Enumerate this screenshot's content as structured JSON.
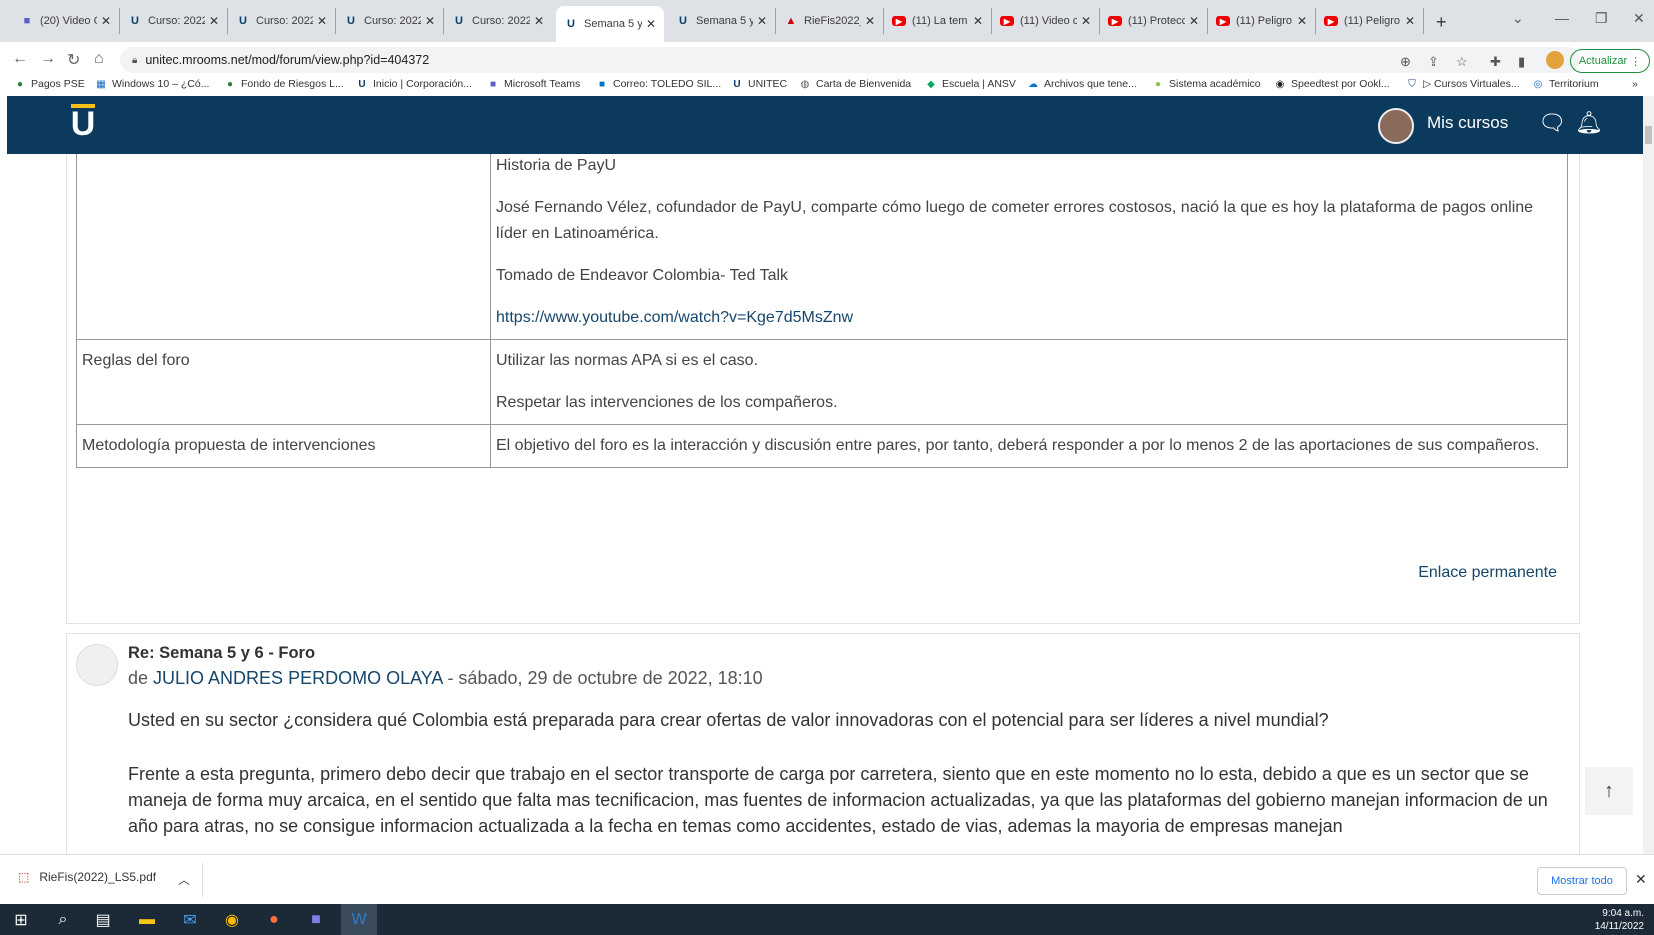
{
  "browser": {
    "tabs": [
      {
        "title": "(20) Video C",
        "icon": "teams-icon"
      },
      {
        "title": "Curso: 2022",
        "icon": "unitec-icon"
      },
      {
        "title": "Curso: 2022",
        "icon": "unitec-icon"
      },
      {
        "title": "Curso: 2022",
        "icon": "unitec-icon"
      },
      {
        "title": "Curso: 2022",
        "icon": "unitec-icon"
      },
      {
        "title": "Semana 5 y",
        "icon": "unitec-icon",
        "active": true
      },
      {
        "title": "Semana 5 y",
        "icon": "unitec-icon"
      },
      {
        "title": "RieFis2022_",
        "icon": "pdf-icon"
      },
      {
        "title": "(11) La tem",
        "icon": "youtube-icon"
      },
      {
        "title": "(11) Video c",
        "icon": "youtube-icon"
      },
      {
        "title": "(11) Protecc",
        "icon": "youtube-icon"
      },
      {
        "title": "(11) Peligro",
        "icon": "youtube-icon"
      },
      {
        "title": "(11) Peligro",
        "icon": "youtube-icon"
      }
    ],
    "url": "unitec.mrooms.net/mod/forum/view.php?id=404372",
    "update_label": "Actualizar",
    "bookmarks": [
      "Pagos PSE",
      "Windows 10 – ¿Có...",
      "Fondo de Riesgos L...",
      "Inicio | Corporación...",
      "Microsoft Teams",
      "Correo: TOLEDO SIL...",
      "UNITEC",
      "Carta de Bienvenida",
      "Escuela | ANSV",
      "Archivos que tene...",
      "Sistema académico",
      "Speedtest por Ookl...",
      "▷ Cursos Virtuales...",
      "Territorium"
    ]
  },
  "navbar": {
    "logo": "U",
    "mis_cursos": "Mis cursos"
  },
  "forum_table": {
    "rows": [
      {
        "key": "",
        "paragraphs": [
          "Historia de PayU",
          "José Fernando Vélez, cofundador de PayU, comparte cómo luego de cometer errores costosos, nació la que es hoy la plataforma de pagos online líder en Latinoamérica.",
          "Tomado de Endeavor Colombia- Ted Talk"
        ],
        "link": "https://www.youtube.com/watch?v=Kge7d5MsZnw"
      },
      {
        "key": "Reglas del foro",
        "paragraphs": [
          "Utilizar las normas APA si es el caso.",
          "Respetar las intervenciones de los compañeros."
        ]
      },
      {
        "key": "Metodología propuesta de intervenciones",
        "paragraphs": [
          "El objetivo del foro es la interacción y discusión entre pares, por tanto, deberá responder a por lo menos 2 de las aportaciones de sus compañeros."
        ]
      }
    ],
    "permalink": "Enlace permanente"
  },
  "reply": {
    "title": "Re: Semana 5 y 6 - Foro",
    "by_prefix": "de ",
    "author": "JULIO ANDRES PERDOMO OLAYA",
    "date": " - sábado, 29 de octubre de 2022, 18:10",
    "body": [
      "Usted en su sector ¿considera qué Colombia está preparada para crear ofertas de valor innovadoras con el potencial para ser líderes a nivel mundial?",
      "Frente a esta pregunta, primero debo decir que trabajo en el sector transporte de carga por carretera, siento que en este momento no lo esta, debido a que es un sector que se maneja de forma muy arcaica, en el sentido que falta mas tecnificacion, mas fuentes de informacion actualizadas, ya que las plataformas del gobierno manejan informacion de un año para atras, no se consigue informacion actualizada a la fecha en temas como accidentes, estado de vias, ademas la mayoria de empresas manejan"
    ]
  },
  "downloads": {
    "file": "RieFis(2022)_LS5.pdf",
    "show_all": "Mostrar todo"
  },
  "taskbar": {
    "time": "9:04 a.m.",
    "date": "14/11/2022"
  }
}
